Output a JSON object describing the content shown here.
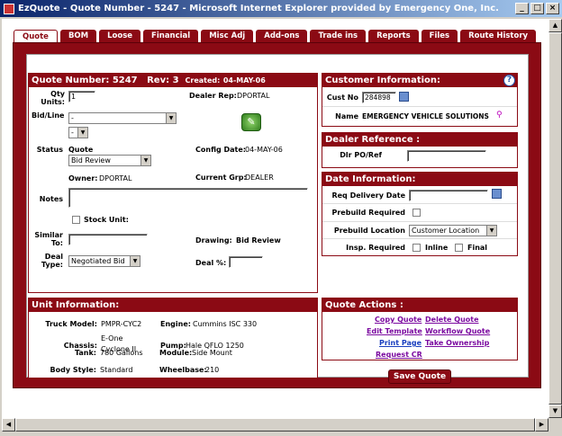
{
  "window": {
    "title": "EzQuote - Quote Number - 5247 - Microsoft Internet Explorer provided by Emergency One, Inc.",
    "min": "_",
    "max": "□",
    "close": "×"
  },
  "tabs": [
    "Quote",
    "BOM",
    "Loose",
    "Financial",
    "Misc Adj",
    "Add-ons",
    "Trade ins",
    "Reports",
    "Files",
    "Route History"
  ],
  "quote": {
    "number_label": "Quote Number:",
    "number": "5247",
    "rev_label": "Rev:",
    "rev": "3",
    "created_label": "Created:",
    "created": "04-MAY-06",
    "qty_label": "Qty Units:",
    "qty": "1",
    "dealer_rep_label": "Dealer Rep:",
    "dealer_rep": "DPORTAL",
    "bidline_label": "Bid/Line",
    "bid_value": "-",
    "line_value": "-",
    "status_label": "Status",
    "status_value": "Quote",
    "status_select": "Bid Review",
    "config_date_label": "Config Date:",
    "config_date": "04-MAY-06",
    "owner_label": "Owner:",
    "owner": "DPORTAL",
    "current_grp_label": "Current Grp:",
    "current_grp": "DEALER",
    "notes_label": "Notes",
    "notes": "",
    "stock_unit_label": "Stock Unit:",
    "similar_label": "Similar To:",
    "similar": "",
    "drawing_label": "Drawing:",
    "drawing": "Bid Review",
    "deal_type_label": "Deal Type:",
    "deal_type": "Negotiated Bid",
    "deal_pct_label": "Deal %:",
    "deal_pct": ""
  },
  "customer": {
    "header": "Customer Information:",
    "cust_no_label": "Cust No",
    "cust_no": "284898",
    "name_label": "Name",
    "name": "EMERGENCY VEHICLE SOLUTIONS"
  },
  "dealer_ref": {
    "header": "Dealer Reference :",
    "po_label": "Dlr PO/Ref",
    "po": ""
  },
  "date_info": {
    "header": "Date Information:",
    "req_delivery_label": "Req Delivery Date",
    "req_delivery": "",
    "prebuild_req_label": "Prebuild Required",
    "prebuild_loc_label": "Prebuild Location",
    "prebuild_loc": "Customer Location",
    "insp_label": "Insp. Required",
    "inline_label": "Inline",
    "final_label": "Final"
  },
  "unit": {
    "header": "Unit Information:",
    "truck_model_label": "Truck Model:",
    "truck_model": "PMPR-CYC2",
    "engine_label": "Engine:",
    "engine": "Cummins ISC 330",
    "chassis_label": "Chassis:",
    "chassis_line1": "E-One",
    "chassis_line2": "Cyclone II",
    "pump_label": "Pump:",
    "pump": "Hale QFLO 1250",
    "tank_label": "Tank:",
    "tank": "780 Gallons",
    "module_label": "Module:",
    "module": "Side Mount",
    "body_label": "Body Style:",
    "body": "Standard",
    "wheelbase_label": "Wheelbase:",
    "wheelbase": "210"
  },
  "actions": {
    "header": "Quote Actions :",
    "copy": "Copy Quote",
    "delete": "Delete Quote",
    "edit": "Edit Template",
    "workflow": "Workflow Quote",
    "print": "Print Page",
    "ownership": "Take Ownership",
    "request_cr": "Request CR"
  },
  "save_label": "Save Quote",
  "icons": {
    "help": "?",
    "calendar": "calendar-icon",
    "search": "magnifier-icon",
    "wrench": "wrench-icon"
  }
}
